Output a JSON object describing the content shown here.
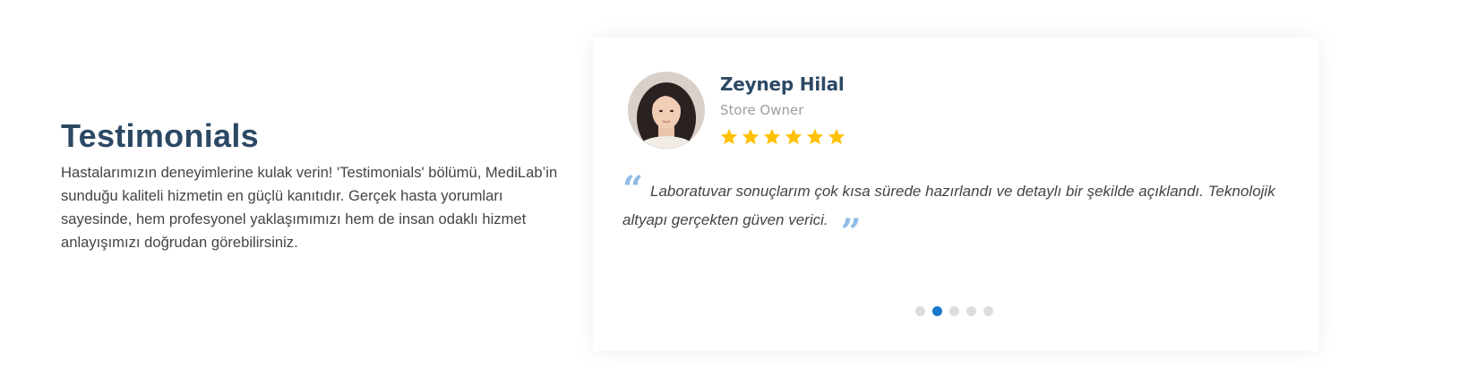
{
  "section": {
    "title": "Testimonials",
    "description": "Hastalarımızın deneyimlerine kulak verin! 'Testimonials' bölümü, MediLab’in sunduğu kaliteli hizmetin en güçlü kanıtıdır. Gerçek hasta yorumları sayesinde, hem profesyonel yaklaşımımızı hem de insan odaklı hizmet anlayışımızı doğrudan görebilirsiniz."
  },
  "testimonial": {
    "name": "Zeynep Hilal",
    "role": "Store Owner",
    "rating": 6,
    "quote_open": "“",
    "quote": "Laboratuvar sonuçlarım çok kısa sürede hazırlandı ve detaylı bir şekilde açıklandı. Teknolojik altyapı gerçekten güven verici.",
    "quote_close": "”"
  },
  "pagination": {
    "count": 5,
    "active_index": 1
  },
  "colors": {
    "heading": "#2c4964",
    "accent": "#1977cc",
    "star": "#ffc107",
    "quote_mark": "#8fbce8",
    "dot_inactive": "#dcdcdc"
  },
  "icons": {
    "rating": "star-icon",
    "quotes": "quote-icon"
  }
}
